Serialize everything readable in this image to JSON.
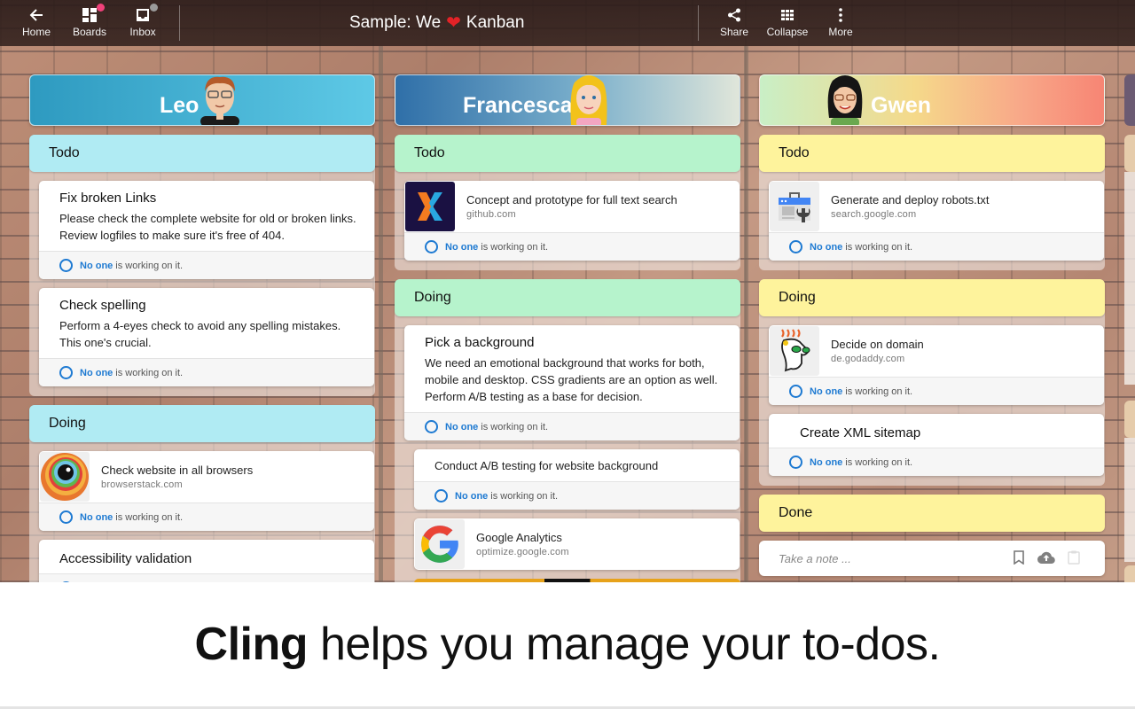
{
  "toolbar": {
    "home_label": "Home",
    "boards_label": "Boards",
    "inbox_label": "Inbox",
    "share_label": "Share",
    "collapse_label": "Collapse",
    "more_label": "More",
    "boards_badge_color": "#f0417a",
    "inbox_badge_color": "#9a9a9a"
  },
  "board": {
    "title_prefix": "Sample: We",
    "title_icon": "heart-icon",
    "title_suffix": "Kanban"
  },
  "status": {
    "assignee": "No one",
    "suffix": "is working on it."
  },
  "columns": [
    {
      "name": "Leo",
      "lane_color": "#b0ebf3",
      "lanes": [
        {
          "title": "Todo",
          "cards": [
            {
              "type": "note",
              "title": "Fix broken Links",
              "description": "Please check the complete website for old or broken links. Review logfiles to make sure it's free of 404."
            },
            {
              "type": "note",
              "title": "Check spelling",
              "description": "Perform a 4-eyes check to avoid any spelling mistakes. This one's crucial."
            }
          ]
        },
        {
          "title": "Doing",
          "cards": [
            {
              "type": "link",
              "title": "Check website in all browsers",
              "domain": "browserstack.com",
              "icon": "browserstack-logo-icon"
            },
            {
              "type": "note",
              "title": "Accessibility validation"
            }
          ]
        }
      ]
    },
    {
      "name": "Francesca",
      "lane_color": "#b6f3cc",
      "lanes": [
        {
          "title": "Todo",
          "cards": [
            {
              "type": "link",
              "title": "Concept and prototype for full text search",
              "domain": "github.com",
              "icon": "x-logo-icon"
            }
          ]
        },
        {
          "title": "Doing",
          "cards": [
            {
              "type": "note",
              "title": "Pick a background",
              "description": "We need an emotional background that works for both, mobile and desktop. CSS gradients are an option as well. Perform A/B testing as a base for decision."
            },
            {
              "type": "plain",
              "title": "Conduct A/B testing for website background"
            },
            {
              "type": "link",
              "title": "Google Analytics",
              "domain": "optimize.google.com",
              "icon": "google-logo-icon"
            }
          ]
        }
      ]
    },
    {
      "name": "Gwen",
      "lane_color": "#fef39c",
      "lanes": [
        {
          "title": "Todo",
          "cards": [
            {
              "type": "link",
              "title": "Generate and deploy robots.txt",
              "domain": "search.google.com",
              "icon": "search-console-logo-icon"
            }
          ]
        },
        {
          "title": "Doing",
          "cards": [
            {
              "type": "link",
              "title": "Decide on domain",
              "domain": "de.godaddy.com",
              "icon": "godaddy-logo-icon"
            },
            {
              "type": "note",
              "title": "Create XML sitemap"
            }
          ]
        },
        {
          "title": "Done",
          "note_placeholder": "Take a note ..."
        }
      ]
    }
  ],
  "caption": {
    "brand": "Cling",
    "text": "helps you manage your to-dos."
  }
}
